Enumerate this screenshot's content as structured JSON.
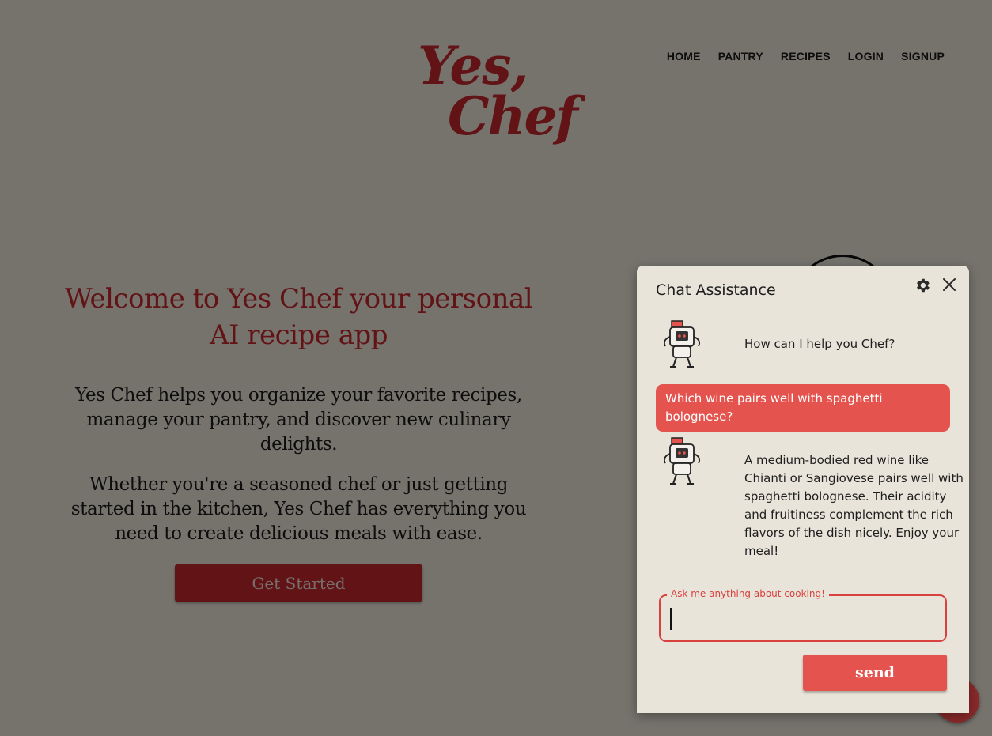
{
  "logo": {
    "line1": "Yes,",
    "line2": "Chef"
  },
  "nav": [
    {
      "label": "HOME"
    },
    {
      "label": "PANTRY"
    },
    {
      "label": "RECIPES"
    },
    {
      "label": "LOGIN"
    },
    {
      "label": "SIGNUP"
    }
  ],
  "hero": {
    "title": "Welcome to Yes Chef your personal AI recipe app",
    "paragraph1": "Yes Chef helps you organize your favorite recipes, manage your pantry, and discover new culinary delights.",
    "paragraph2": "Whether you're a seasoned chef or just getting started in the kitchen, Yes Chef has everything you need to create delicious meals with ease.",
    "cta_label": "Get Started"
  },
  "chat": {
    "title": "Chat Assistance",
    "messages": [
      {
        "role": "bot",
        "text": "How can I help you Chef?"
      },
      {
        "role": "user",
        "text": "Which wine pairs well with spaghetti bolognese?"
      },
      {
        "role": "bot",
        "text": "A medium-bodied red wine like Chianti or Sangiovese pairs well with spaghetti bolognese. Their acidity and fruitiness complement the rich flavors of the dish nicely. Enjoy your meal!"
      }
    ],
    "input_label": "Ask me anything about cooking!",
    "input_value": "",
    "send_label": "send"
  },
  "icons": {
    "settings": "gear-icon",
    "close": "close-icon",
    "assistant_avatar": "robot-chef-icon"
  },
  "colors": {
    "brand_red": "#c2272d",
    "accent_red": "#e4534d",
    "panel_bg": "#e9e4da",
    "page_bg": "#ede6da"
  }
}
